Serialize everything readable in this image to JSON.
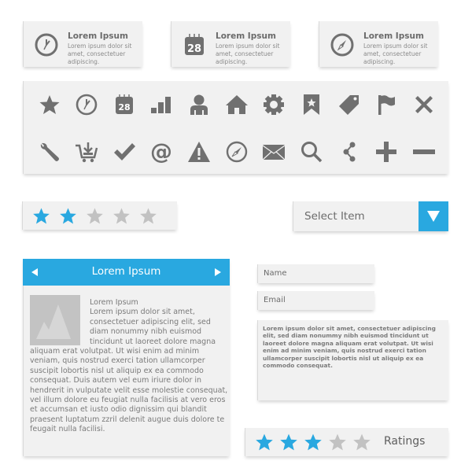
{
  "colors": {
    "accent": "#29a8e0",
    "icon": "#707070",
    "panel": "#f1f1f1",
    "star_on": "#29a8e0",
    "star_off": "#c2c2c2",
    "image_placeholder": "#c3c3c3"
  },
  "info_cards": [
    {
      "icon": "clock-icon",
      "title": "Lorem Ipsum",
      "desc": "Lorem ipsum dolor sit amet, consectetuer adipiscing."
    },
    {
      "icon": "calendar-icon",
      "icon_text": "28",
      "title": "Lorem Ipsum",
      "desc": "Lorem ipsum dolor sit amet, consectetuer adipiscing."
    },
    {
      "icon": "compass-icon",
      "title": "Lorem Ipsum",
      "desc": "Lorem ipsum dolor sit amet, consectetuer adipiscing."
    }
  ],
  "icon_grid": {
    "row1": [
      "star-icon",
      "clock-icon",
      "calendar-icon",
      "signal-bars-icon",
      "user-icon",
      "home-icon",
      "gear-icon",
      "bookmark-icon",
      "tag-icon",
      "flag-icon",
      "close-icon"
    ],
    "row2": [
      "wrench-icon",
      "cart-download-icon",
      "checkmark-icon",
      "at-sign-icon",
      "warning-icon",
      "compass-icon",
      "mail-icon",
      "search-icon",
      "share-icon",
      "plus-icon",
      "minus-icon"
    ],
    "calendar_text": "28"
  },
  "rating_small": {
    "value": 2,
    "max": 5
  },
  "select": {
    "label": "Select Item",
    "icon": "chevron-down-icon"
  },
  "card": {
    "title": "Lorem Ipsum",
    "prev_icon": "arrow-left-icon",
    "next_icon": "arrow-right-icon",
    "subtitle": "Lorem Ipsum",
    "text_side": "Lorem ipsum dolor sit amet, consectetuer adipiscing elit, sed diam nonummy nibh euismod tincidunt ut laoreet dolore magna",
    "text_body": "aliquam erat volutpat. Ut wisi enim ad minim veniam, quis nostrud exerci tation ullamcorper suscipit lobortis nisl ut aliquip ex ea commodo consequat. Duis autem vel eum iriure dolor in hendrerit in vulputate velit esse molestie consequat, vel illum dolore eu feugiat nulla facilisis at vero eros et accumsan et iusto odio dignissim qui blandit praesent luptatum zzril delenit augue duis dolore te feugait nulla facilisi."
  },
  "form": {
    "name_placeholder": "Name",
    "email_placeholder": "Email",
    "message": "Lorem ipsum dolor sit amet, consectetuer adipiscing elit, sed diam nonummy nibh euismod tincidunt ut laoreet dolore magna aliquam erat volutpat. Ut wisi enim ad minim veniam, quis nostrud exerci tation ullamcorper suscipit lobortis nisl ut aliquip ex ea commodo consequat."
  },
  "rating_large": {
    "value": 3,
    "max": 5,
    "label": "Ratings"
  }
}
